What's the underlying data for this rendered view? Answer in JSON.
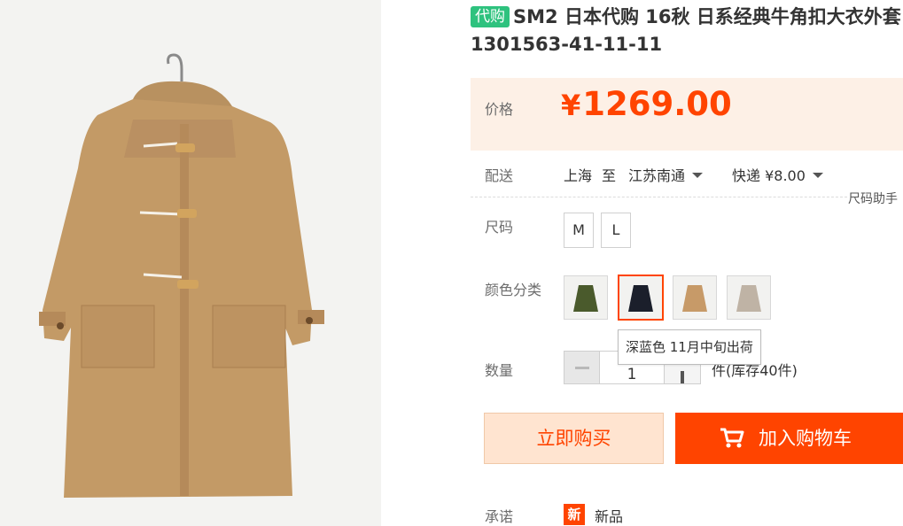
{
  "product": {
    "badge": "代购",
    "title": "SM2 日本代购 16秋 日系经典牛角扣大衣外套 1301563-41-11-11"
  },
  "price": {
    "label": "价格",
    "currency": "¥",
    "value": "1269.00",
    "color": "#ff4400"
  },
  "delivery": {
    "label": "配送",
    "from": "上海",
    "to_word": "至",
    "destination": "江苏南通",
    "shipping": "快递 ¥8.00"
  },
  "size_helper": "尺码助手",
  "size": {
    "label": "尺码",
    "options": [
      "M",
      "L"
    ]
  },
  "colors": {
    "label": "颜色分类",
    "options": [
      {
        "icon": "olive-coat-thumbnail",
        "hex": "#4a5a2c"
      },
      {
        "icon": "navy-coat-thumbnail",
        "hex": "#1b1f2b",
        "selected": true
      },
      {
        "icon": "camel-coat-thumbnail",
        "hex": "#c79a68"
      },
      {
        "icon": "grey-coat-thumbnail",
        "hex": "#bfb3a5"
      }
    ],
    "tooltip": "深蓝色 11月中旬出荷"
  },
  "quantity": {
    "label": "数量",
    "value": "1",
    "stock_text": "件(库存40件)"
  },
  "buttons": {
    "buy_now": "立即购买",
    "add_to_cart": "加入购物车"
  },
  "promise": {
    "label": "承诺",
    "icon_text": "新",
    "text": "新品"
  }
}
